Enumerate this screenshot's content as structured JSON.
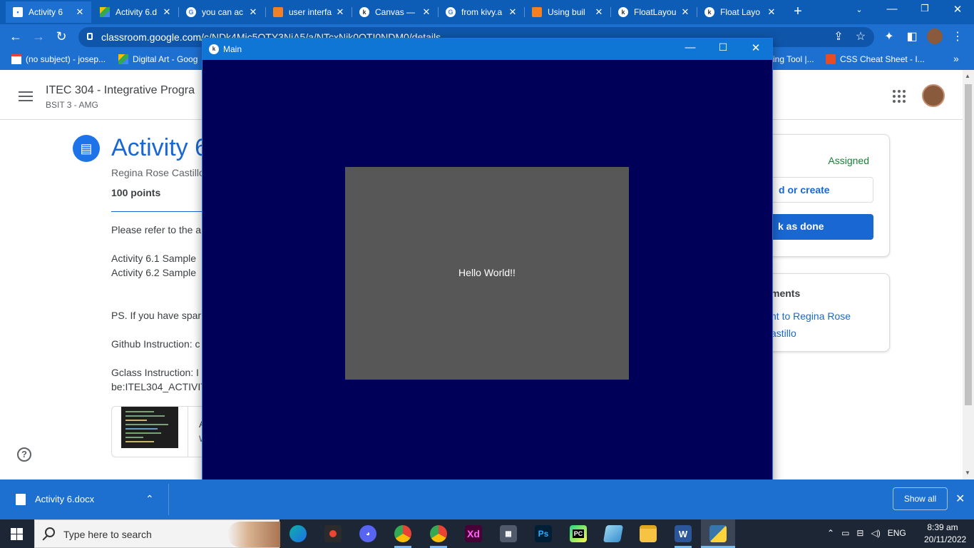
{
  "browser": {
    "tabs": [
      {
        "title": "Activity 6",
        "active": true
      },
      {
        "title": "Activity 6.d",
        "active": false
      },
      {
        "title": "you can ac",
        "active": false
      },
      {
        "title": "user interfa",
        "active": false
      },
      {
        "title": "Canvas —",
        "active": false
      },
      {
        "title": "from kivy.a",
        "active": false
      },
      {
        "title": "Using buil",
        "active": false
      },
      {
        "title": "FloatLayou",
        "active": false
      },
      {
        "title": "Float Layo",
        "active": false
      }
    ],
    "new_tab_icon": "plus-icon",
    "url": "classroom.google.com/c/NDk4Mjc5OTY3NjA5/a/NTcxNjk0OTI0NDM0/details",
    "bookmarks": [
      {
        "label": "(no subject) - josep..."
      },
      {
        "label": "Digital Art - Goog"
      },
      {
        "label": "ing Tool |..."
      },
      {
        "label": "CSS Cheat Sheet - I..."
      }
    ],
    "more_bookmarks": "»"
  },
  "classroom": {
    "course_title": "ITEC 304 - Integrative Progra",
    "course_section": "BSIT 3 - AMG",
    "assignment_title": "Activity 6",
    "author": "Regina Rose Castillo",
    "points": "100 points",
    "body_lines": [
      "Please refer to the a",
      "Activity 6.1 Sample",
      "Activity 6.2 Sample",
      "PS. If you have spar",
      "Github Instruction: c",
      "Gclass Instruction: I",
      "be:ITEL304_ACTIVIT"
    ],
    "attachment_title": "A",
    "attachment_subtitle": "W",
    "status": "Assigned",
    "add_create_label": "d or create",
    "mark_done_label": "k as done",
    "comments_heading": "ments",
    "comment_link_line1": "nt to Regina Rose",
    "comment_link_line2": "astillo",
    "help_symbol": "?"
  },
  "kivy_window": {
    "title": "Main",
    "label_text": "Hello World!!",
    "background_color": "#000058",
    "label_background": "#575757"
  },
  "downloads": {
    "file_name": "Activity 6.docx",
    "show_all_label": "Show all"
  },
  "taskbar": {
    "search_placeholder": "Type here to search",
    "apps": [
      "edge-icon",
      "recorder-icon",
      "discord-icon",
      "chrome-icon",
      "chrome-profile-icon",
      "adobe-xd-icon",
      "calculator-icon",
      "photoshop-icon",
      "pycharm-icon",
      "notepad-icon",
      "file-explorer-icon",
      "word-icon",
      "python-icon"
    ],
    "app_labels": {
      "xd": "Xd",
      "ps": "Ps",
      "pc": "PC",
      "word": "W"
    },
    "language": "ENG",
    "time": "8:39 am",
    "date": "20/11/2022"
  },
  "colors": {
    "chrome_accent": "#1d6fd0",
    "classroom_blue": "#1967d2",
    "assigned_green": "#188038"
  }
}
